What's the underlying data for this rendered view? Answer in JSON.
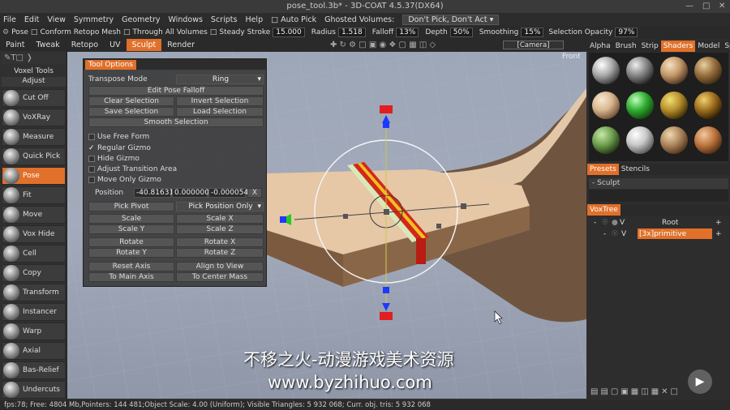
{
  "window": {
    "title": "pose_tool.3b* - 3D-COAT 4.5.37(DX64)"
  },
  "menu": {
    "items": [
      "File",
      "Edit",
      "View",
      "Symmetry",
      "Geometry",
      "Windows",
      "Scripts",
      "Help"
    ],
    "auto_pick": "Auto Pick",
    "ghosted_label": "Ghosted Volumes:",
    "ghosted_value": "Don't Pick, Don't Act"
  },
  "toolbar": {
    "pose": "Pose",
    "conform": "Conform Retopo Mesh",
    "through": "Through All Volumes",
    "steady": "Steady Stroke",
    "steady_val": "15.000",
    "radius": "Radius",
    "radius_val": "1.518",
    "falloff": "Falloff",
    "falloff_val": "13%",
    "depth": "Depth",
    "depth_val": "50%",
    "smoothing": "Smoothing",
    "smoothing_val": "15%",
    "sel_opacity": "Selection Opacity",
    "sel_opacity_val": "97%"
  },
  "rooms": {
    "tabs": [
      "Paint",
      "Tweak",
      "Retopo",
      "UV",
      "Sculpt",
      "Render"
    ],
    "active": "Sculpt",
    "camera": "[Camera]",
    "view": "Front"
  },
  "left": {
    "voxel_tools": "Voxel Tools",
    "adjust": "Adjust",
    "tools": [
      "Cut Off",
      "VoXRay",
      "Measure",
      "Quick Pick",
      "Pose",
      "Fit",
      "Move",
      "Vox Hide",
      "Cell",
      "Copy",
      "Transform",
      "Instancer",
      "Warp",
      "Axial",
      "Bas-Relief",
      "Undercuts"
    ],
    "active_tool": "Pose"
  },
  "tool_options": {
    "title": "Tool Options",
    "transpose_mode_label": "Transpose Mode",
    "transpose_mode_value": "Ring",
    "edit_falloff": "Edit Pose Falloff",
    "clear_sel": "Clear Selection",
    "invert_sel": "Invert Selection",
    "save_sel": "Save Selection",
    "load_sel": "Load Selection",
    "smooth_sel": "Smooth Selection",
    "checks": [
      {
        "label": "Use Free Form",
        "checked": false
      },
      {
        "label": "Regular Gizmo",
        "checked": true
      },
      {
        "label": "Hide Gizmo",
        "checked": false
      },
      {
        "label": "Adjust Transition Area",
        "checked": false
      },
      {
        "label": "Move Only Gizmo",
        "checked": false
      }
    ],
    "position_label": "Position",
    "pos_x": "-40.81631",
    "pos_y": "0.000000",
    "pos_z": "-0.000054",
    "pos_clear": "X",
    "pick_pivot": "Pick Pivot",
    "pick_mode": "Pick Position Only",
    "scale": "Scale",
    "scale_x": "Scale X",
    "scale_y": "Scale Y",
    "scale_z": "Scale Z",
    "rotate": "Rotate",
    "rotate_x": "Rotate X",
    "rotate_y": "Rotate Y",
    "rotate_z": "Rotate Z",
    "reset_axis": "Reset Axis",
    "align_view": "Align to View",
    "main_axis": "To Main Axis",
    "center_mass": "To Center Mass"
  },
  "right": {
    "top_tabs": [
      "Alpha",
      "Brush",
      "Strip",
      "Shaders",
      "Model",
      "Spline"
    ],
    "top_active": "Shaders",
    "preset_tabs": [
      "Presets",
      "Stencils"
    ],
    "preset_active": "Presets",
    "preset_folder": "Sculpt",
    "voxtree_tab": "VoxTree",
    "root": "Root",
    "primitive": "[3x]primitive",
    "vis_flag": "V"
  },
  "status": {
    "text": "fps:78;    Free: 4804 Mb,Pointers: 144 481;Object Scale: 4.00 (Uniform); Visible Triangles: 5 932 068; Curr. obj. tris: 5 932 068"
  },
  "watermark": {
    "line1": "不移之火-动漫游戏美术资源",
    "line2": "www.byzhihuo.com"
  },
  "colors": {
    "accent": "#e0702a"
  }
}
